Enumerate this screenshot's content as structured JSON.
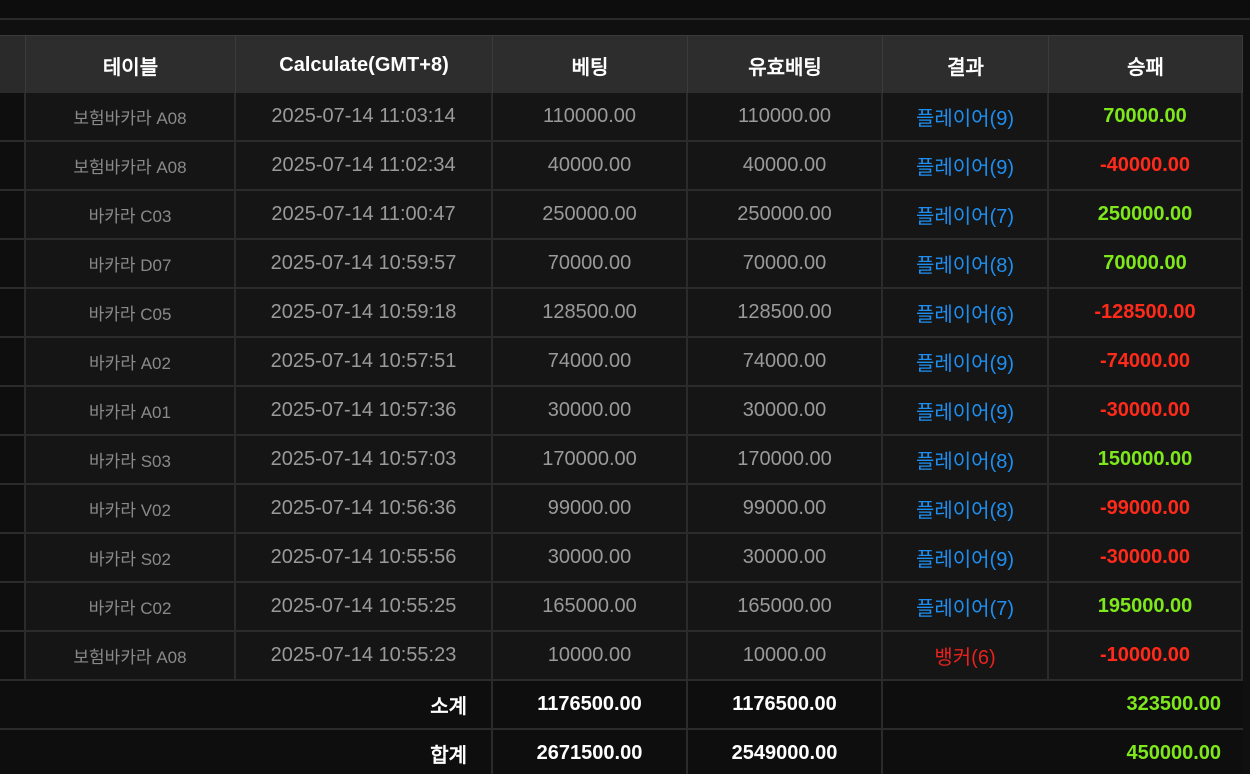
{
  "columns": [
    "테이블",
    "Calculate(GMT+8)",
    "베팅",
    "유효배팅",
    "결과",
    "승패"
  ],
  "rows": [
    {
      "table": "보험바카라 A08",
      "time": "2025-07-14 11:03:14",
      "bet": "110000.00",
      "valid": "110000.00",
      "result": "플레이어(9)",
      "winloss": "70000.00"
    },
    {
      "table": "보험바카라 A08",
      "time": "2025-07-14 11:02:34",
      "bet": "40000.00",
      "valid": "40000.00",
      "result": "플레이어(9)",
      "winloss": "-40000.00"
    },
    {
      "table": "바카라 C03",
      "time": "2025-07-14 11:00:47",
      "bet": "250000.00",
      "valid": "250000.00",
      "result": "플레이어(7)",
      "winloss": "250000.00"
    },
    {
      "table": "바카라 D07",
      "time": "2025-07-14 10:59:57",
      "bet": "70000.00",
      "valid": "70000.00",
      "result": "플레이어(8)",
      "winloss": "70000.00"
    },
    {
      "table": "바카라 C05",
      "time": "2025-07-14 10:59:18",
      "bet": "128500.00",
      "valid": "128500.00",
      "result": "플레이어(6)",
      "winloss": "-128500.00"
    },
    {
      "table": "바카라 A02",
      "time": "2025-07-14 10:57:51",
      "bet": "74000.00",
      "valid": "74000.00",
      "result": "플레이어(9)",
      "winloss": "-74000.00"
    },
    {
      "table": "바카라 A01",
      "time": "2025-07-14 10:57:36",
      "bet": "30000.00",
      "valid": "30000.00",
      "result": "플레이어(9)",
      "winloss": "-30000.00"
    },
    {
      "table": "바카라 S03",
      "time": "2025-07-14 10:57:03",
      "bet": "170000.00",
      "valid": "170000.00",
      "result": "플레이어(8)",
      "winloss": "150000.00"
    },
    {
      "table": "바카라 V02",
      "time": "2025-07-14 10:56:36",
      "bet": "99000.00",
      "valid": "99000.00",
      "result": "플레이어(8)",
      "winloss": "-99000.00"
    },
    {
      "table": "바카라 S02",
      "time": "2025-07-14 10:55:56",
      "bet": "30000.00",
      "valid": "30000.00",
      "result": "플레이어(9)",
      "winloss": "-30000.00"
    },
    {
      "table": "바카라 C02",
      "time": "2025-07-14 10:55:25",
      "bet": "165000.00",
      "valid": "165000.00",
      "result": "플레이어(7)",
      "winloss": "195000.00"
    },
    {
      "table": "보험바카라 A08",
      "time": "2025-07-14 10:55:23",
      "bet": "10000.00",
      "valid": "10000.00",
      "result": "뱅커(6)",
      "winloss": "-10000.00"
    }
  ],
  "subtotal": {
    "label": "소계",
    "bet": "1176500.00",
    "valid": "1176500.00",
    "winloss": "323500.00"
  },
  "total": {
    "label": "합계",
    "bet": "2671500.00",
    "valid": "2549000.00",
    "winloss": "450000.00"
  },
  "colors": {
    "player": "#1e8ff0",
    "banker": "#e8221e",
    "win": "#7ee81a",
    "loss": "#ff2a1a"
  }
}
